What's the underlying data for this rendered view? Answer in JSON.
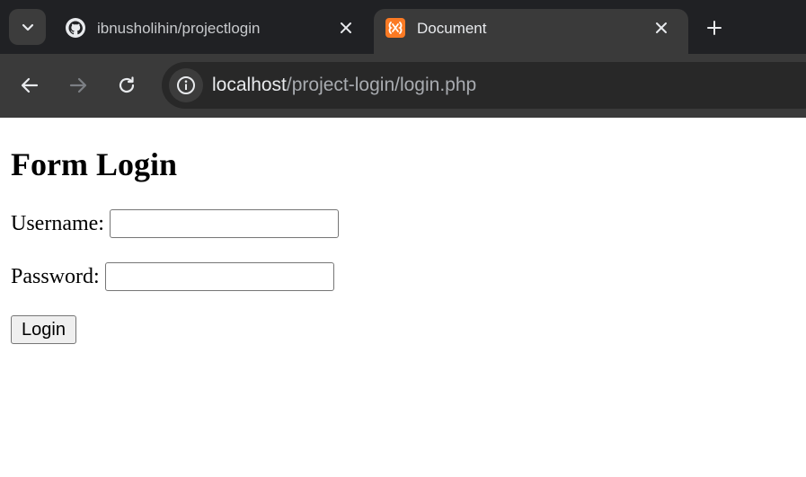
{
  "browser": {
    "tabs": [
      {
        "title": "ibnusholihin/projectlogin",
        "favicon": "github-icon",
        "active": false
      },
      {
        "title": "Document",
        "favicon": "xampp-icon",
        "active": true
      }
    ],
    "address": {
      "host": "localhost",
      "path": "/project-login/login.php"
    },
    "colors": {
      "tabstrip": "#202124",
      "toolbar": "#3a3a3a",
      "omnibox": "#282828",
      "xampp_orange": "#fb7a24"
    }
  },
  "page": {
    "title": "Form Login",
    "username": {
      "label": "Username:",
      "value": "",
      "placeholder": ""
    },
    "password": {
      "label": "Password:",
      "value": "",
      "placeholder": ""
    },
    "login_label": "Login"
  }
}
